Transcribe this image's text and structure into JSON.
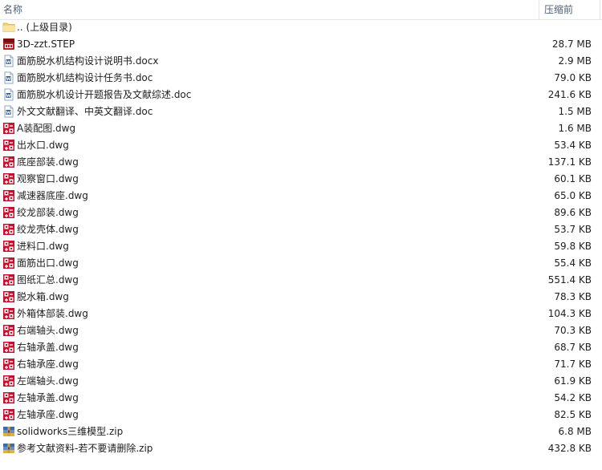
{
  "columns": {
    "name": "名称",
    "size": "压缩前"
  },
  "parent": {
    "name": ".. (上级目录)",
    "icon": "folder-icon"
  },
  "files": [
    {
      "name": "3D-zzt.STEP",
      "size": "28.7 MB",
      "icon": "step-file-icon"
    },
    {
      "name": "面筋脱水机结构设计说明书.docx",
      "size": "2.9 MB",
      "icon": "word-doc-icon"
    },
    {
      "name": "面筋脱水机结构设计任务书.doc",
      "size": "79.0 KB",
      "icon": "word-doc-icon"
    },
    {
      "name": "面筋脱水机设计开题报告及文献综述.doc",
      "size": "241.6 KB",
      "icon": "word-doc-icon"
    },
    {
      "name": "外文文献翻译、中英文翻译.doc",
      "size": "1.5 MB",
      "icon": "word-doc-icon"
    },
    {
      "name": "A装配图.dwg",
      "size": "1.6 MB",
      "icon": "dwg-file-icon"
    },
    {
      "name": "出水口.dwg",
      "size": "53.4 KB",
      "icon": "dwg-file-icon"
    },
    {
      "name": "底座部装.dwg",
      "size": "137.1 KB",
      "icon": "dwg-file-icon"
    },
    {
      "name": "观察窗口.dwg",
      "size": "60.1 KB",
      "icon": "dwg-file-icon"
    },
    {
      "name": "减速器底座.dwg",
      "size": "65.0 KB",
      "icon": "dwg-file-icon"
    },
    {
      "name": "绞龙部装.dwg",
      "size": "89.6 KB",
      "icon": "dwg-file-icon"
    },
    {
      "name": "绞龙壳体.dwg",
      "size": "53.7 KB",
      "icon": "dwg-file-icon"
    },
    {
      "name": "进料口.dwg",
      "size": "59.8 KB",
      "icon": "dwg-file-icon"
    },
    {
      "name": "面筋出口.dwg",
      "size": "55.4 KB",
      "icon": "dwg-file-icon"
    },
    {
      "name": "图纸汇总.dwg",
      "size": "551.4 KB",
      "icon": "dwg-file-icon"
    },
    {
      "name": "脱水箱.dwg",
      "size": "78.3 KB",
      "icon": "dwg-file-icon"
    },
    {
      "name": "外箱体部装.dwg",
      "size": "104.3 KB",
      "icon": "dwg-file-icon"
    },
    {
      "name": "右端轴头.dwg",
      "size": "70.3 KB",
      "icon": "dwg-file-icon"
    },
    {
      "name": "右轴承盖.dwg",
      "size": "68.7 KB",
      "icon": "dwg-file-icon"
    },
    {
      "name": "右轴承座.dwg",
      "size": "71.7 KB",
      "icon": "dwg-file-icon"
    },
    {
      "name": "左端轴头.dwg",
      "size": "61.9 KB",
      "icon": "dwg-file-icon"
    },
    {
      "name": "左轴承盖.dwg",
      "size": "54.2 KB",
      "icon": "dwg-file-icon"
    },
    {
      "name": "左轴承座.dwg",
      "size": "82.5 KB",
      "icon": "dwg-file-icon"
    },
    {
      "name": "solidworks三维模型.zip",
      "size": "6.8 MB",
      "icon": "zip-archive-icon"
    },
    {
      "name": "参考文献资料-若不要请删除.zip",
      "size": "432.8 KB",
      "icon": "zip-archive-icon"
    }
  ],
  "colors": {
    "header_text": "#4c607a",
    "text": "#1e1e1e",
    "folder": "#f5d27a",
    "dwg": "#c8102e",
    "word": "#2b5797"
  }
}
